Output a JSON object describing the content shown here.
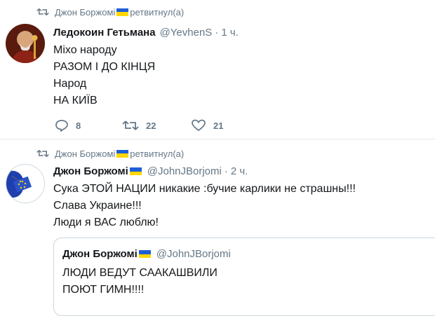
{
  "tweets": [
    {
      "retweeted_by": "Джон Боржомі",
      "retweeted_suffix": "ретвитнул(а)",
      "author_name": "Ледокоин Гетьмана",
      "author_handle": "@YevhenS",
      "time": "1 ч.",
      "lines": [
        "Міхо народу",
        "РАЗОМ І ДО КІНЦЯ",
        "Народ",
        "НА КИЇВ"
      ],
      "replies": "8",
      "retweets": "22",
      "likes": "21"
    },
    {
      "retweeted_by": "Джон Боржомі",
      "retweeted_suffix": "ретвитнул(а)",
      "author_name": "Джон Боржомі",
      "author_handle": "@JohnJBorjomi",
      "time": "2 ч.",
      "lines": [
        "Сука ЭТОЙ НАЦИИ никакие  :бучие карлики не страшны!!!",
        "Слава Украине!!!",
        "Люди я ВАС люблю!"
      ],
      "quote": {
        "author_name": "Джон Боржомі",
        "author_handle": "@JohnJBorjomi",
        "lines": [
          "ЛЮДИ ВЕДУТ СААКАШВИЛИ",
          "ПОЮТ ГИМН!!!!"
        ]
      }
    }
  ],
  "separator_dot": "·",
  "colors": {
    "flag_blue": "#1f5fd6",
    "flag_yellow": "#ffd700",
    "secondary_text": "#657786"
  }
}
